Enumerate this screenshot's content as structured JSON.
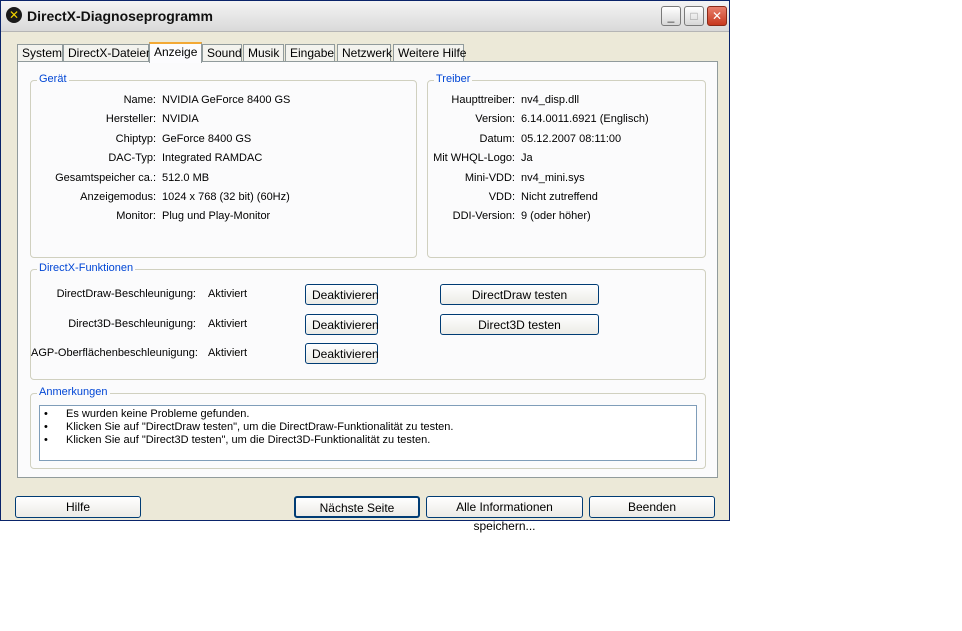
{
  "window": {
    "title": "DirectX-Diagnoseprogramm"
  },
  "tabs": [
    {
      "label": "System"
    },
    {
      "label": "DirectX-Dateien"
    },
    {
      "label": "Anzeige"
    },
    {
      "label": "Sound"
    },
    {
      "label": "Musik"
    },
    {
      "label": "Eingabe"
    },
    {
      "label": "Netzwerk"
    },
    {
      "label": "Weitere Hilfe"
    }
  ],
  "device": {
    "title": "Gerät",
    "rows": [
      {
        "label": "Name:",
        "value": "NVIDIA GeForce 8400 GS"
      },
      {
        "label": "Hersteller:",
        "value": "NVIDIA"
      },
      {
        "label": "Chiptyp:",
        "value": "GeForce 8400 GS"
      },
      {
        "label": "DAC-Typ:",
        "value": "Integrated RAMDAC"
      },
      {
        "label": "Gesamtspeicher ca.:",
        "value": "512.0 MB"
      },
      {
        "label": "Anzeigemodus:",
        "value": "1024 x 768 (32 bit) (60Hz)"
      },
      {
        "label": "Monitor:",
        "value": "Plug und Play-Monitor"
      }
    ]
  },
  "driver": {
    "title": "Treiber",
    "rows": [
      {
        "label": "Haupttreiber:",
        "value": "nv4_disp.dll"
      },
      {
        "label": "Version:",
        "value": "6.14.0011.6921 (Englisch)"
      },
      {
        "label": "Datum:",
        "value": "05.12.2007 08:11:00"
      },
      {
        "label": "Mit WHQL-Logo:",
        "value": "Ja"
      },
      {
        "label": "Mini-VDD:",
        "value": "nv4_mini.sys"
      },
      {
        "label": "VDD:",
        "value": "Nicht zutreffend"
      },
      {
        "label": "DDI-Version:",
        "value": "9 (oder höher)"
      }
    ]
  },
  "features": {
    "title": "DirectX-Funktionen",
    "rows": [
      {
        "label": "DirectDraw-Beschleunigung:",
        "status": "Aktiviert",
        "toggle": "Deaktivieren",
        "test": "DirectDraw testen"
      },
      {
        "label": "Direct3D-Beschleunigung:",
        "status": "Aktiviert",
        "toggle": "Deaktivieren",
        "test": "Direct3D testen"
      },
      {
        "label": "AGP-Oberflächenbeschleunigung:",
        "status": "Aktiviert",
        "toggle": "Deaktivieren"
      }
    ]
  },
  "notes": {
    "title": "Anmerkungen",
    "bullet": "•",
    "items": [
      "Es wurden keine Probleme gefunden.",
      "Klicken Sie auf \"DirectDraw testen\", um die DirectDraw-Funktionalität zu testen.",
      "Klicken Sie auf \"Direct3D testen\", um die Direct3D-Funktionalität zu testen."
    ]
  },
  "footer": {
    "help": "Hilfe",
    "next": "Nächste Seite",
    "save": "Alle Informationen speichern...",
    "exit": "Beenden"
  }
}
